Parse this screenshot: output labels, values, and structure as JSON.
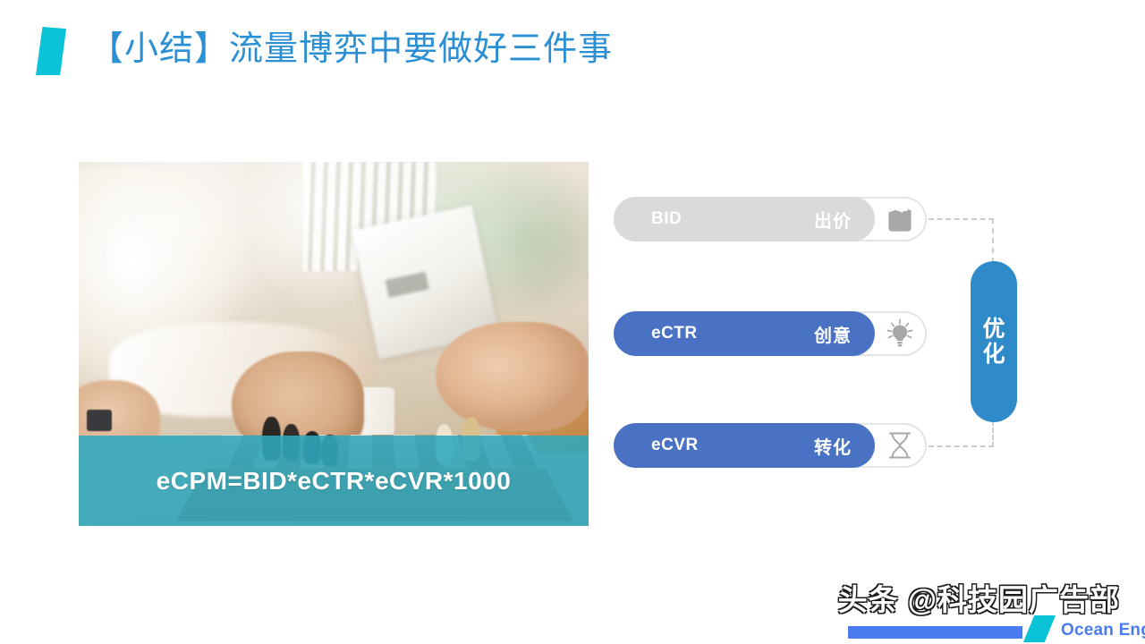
{
  "slide": {
    "title": "【小结】流量博弈中要做好三件事",
    "accent_color": "#0bc3d6",
    "title_color": "#2b8fd4"
  },
  "photo": {
    "alt": "两人下棋的照片",
    "caption": "eCPM=BID*eCTR*eCVR*1000",
    "caption_band_color": "#30a8be"
  },
  "diagram": {
    "metrics": [
      {
        "key": "BID",
        "label": "出价",
        "icon": "money-bundle-icon",
        "pill_color": "#d9dadb",
        "state": "inactive"
      },
      {
        "key": "eCTR",
        "label": "创意",
        "icon": "lightbulb-icon",
        "pill_color": "#4a72c4",
        "state": "active"
      },
      {
        "key": "eCVR",
        "label": "转化",
        "icon": "hourglass-icon",
        "pill_color": "#4a72c4",
        "state": "active"
      }
    ],
    "optimize": {
      "label": "优化",
      "color": "#2f8ac9"
    },
    "connector_color": "#c9cbcd"
  },
  "footer": {
    "watermark": "头条 @科技园广告部",
    "logo_text": "Ocean Engine",
    "logo_bar_color": "#4a7cf0",
    "logo_slant_color": "#0bc3d6"
  }
}
